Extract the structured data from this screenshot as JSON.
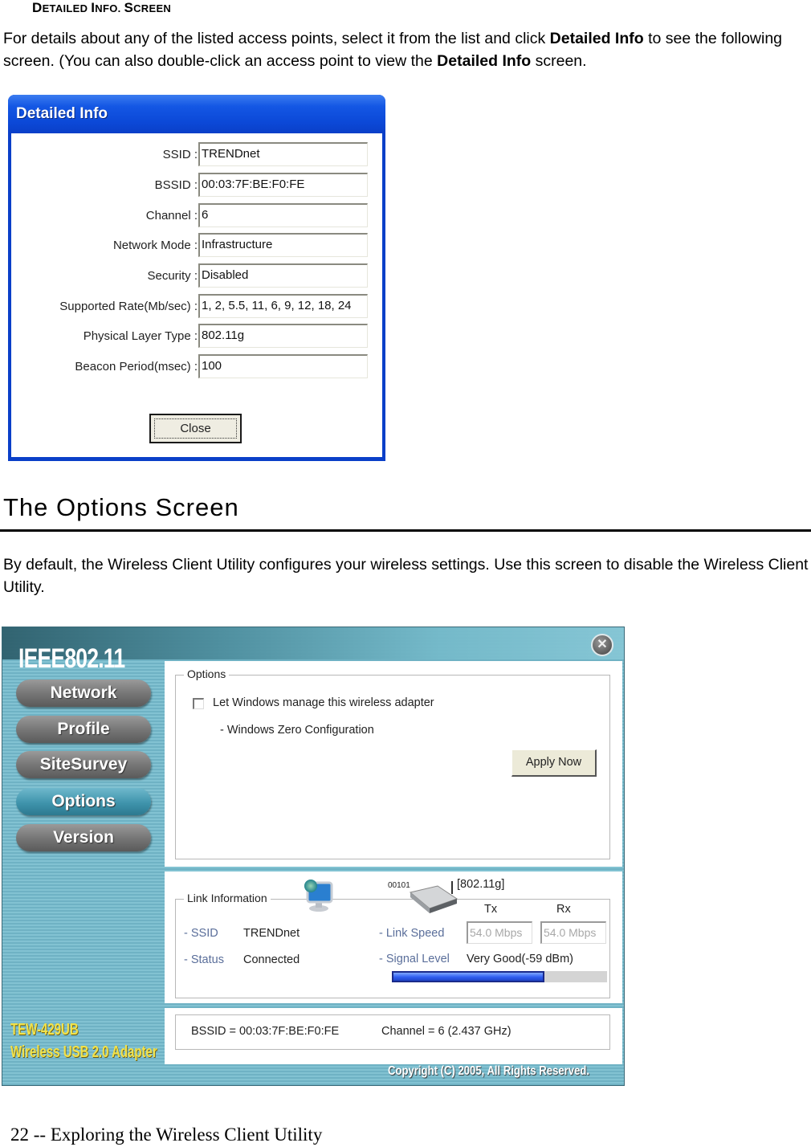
{
  "section": {
    "heading": "Detailed Info. Screen",
    "heading_parts": [
      {
        "cap": "D",
        "rest": "ETAILED "
      },
      {
        "cap": "I",
        "rest": "NFO. "
      },
      {
        "cap": "S",
        "rest": "CREEN"
      }
    ],
    "paragraph": {
      "t1": "For details about any of the listed access points, select it from the list and click ",
      "b1": "Detailed Info",
      "t2": " to see the following screen. (You can also double-click an access point to view the ",
      "b2": "Detailed Info",
      "t3": " screen."
    }
  },
  "detailed_info_dialog": {
    "title": "Detailed Info",
    "fields": [
      {
        "label": "SSID :",
        "value": "TRENDnet"
      },
      {
        "label": "BSSID :",
        "value": "00:03:7F:BE:F0:FE"
      },
      {
        "label": "Channel :",
        "value": "6"
      },
      {
        "label": "Network Mode :",
        "value": "Infrastructure"
      },
      {
        "label": "Security :",
        "value": "Disabled"
      },
      {
        "label": "Supported Rate(Mb/sec) :",
        "value": "1, 2, 5.5, 11, 6, 9, 12, 18, 24"
      },
      {
        "label": "Physical Layer Type :",
        "value": "802.11g"
      },
      {
        "label": "Beacon Period(msec) :",
        "value": "100"
      }
    ],
    "close_label": "Close"
  },
  "options_section": {
    "heading": "The Options Screen",
    "paragraph": "By default, the Wireless Client Utility configures your wireless settings. Use this screen to disable the Wireless Client Utility."
  },
  "utility_window": {
    "brand": "IEEE802.11",
    "close_icon": "close-circle-icon",
    "close_glyph": "✕",
    "nav": [
      {
        "label": "Network",
        "active": false
      },
      {
        "label": "Profile",
        "active": false
      },
      {
        "label": "SiteSurvey",
        "active": false
      },
      {
        "label": "Options",
        "active": true
      },
      {
        "label": "Version",
        "active": false
      }
    ],
    "options_group": {
      "legend": "Options",
      "checkbox_label": "Let Windows manage this wireless adapter",
      "checkbox_checked": false,
      "sub_label": "- Windows Zero Configuration",
      "apply_label": "Apply Now"
    },
    "link_info": {
      "legend": "Link Information",
      "computer_icon": "computer-icon",
      "router_icon": "router-icon",
      "router_bits": "00101",
      "mode": "[802.11g]",
      "ssid_label": "- SSID",
      "ssid_value": "TRENDnet",
      "status_label": "- Status",
      "status_value": "Connected",
      "tx_header": "Tx",
      "rx_header": "Rx",
      "link_speed_label": "- Link Speed",
      "tx_speed": "54.0 Mbps",
      "rx_speed": "54.0 Mbps",
      "signal_label": "- Signal Level",
      "signal_value": "Very Good(-59 dBm)",
      "signal_fraction": 0.71
    },
    "bottom_bar": {
      "bssid": "BSSID = 00:03:7F:BE:F0:FE",
      "channel": "Channel = 6 (2.437 GHz)"
    },
    "model_line1": "TEW-429UB",
    "model_line2": "Wireless USB 2.0 Adapter",
    "copyright": "Copyright (C) 2005, All Rights Reserved."
  },
  "footer": "22 -- Exploring the Wireless Client Utility"
}
